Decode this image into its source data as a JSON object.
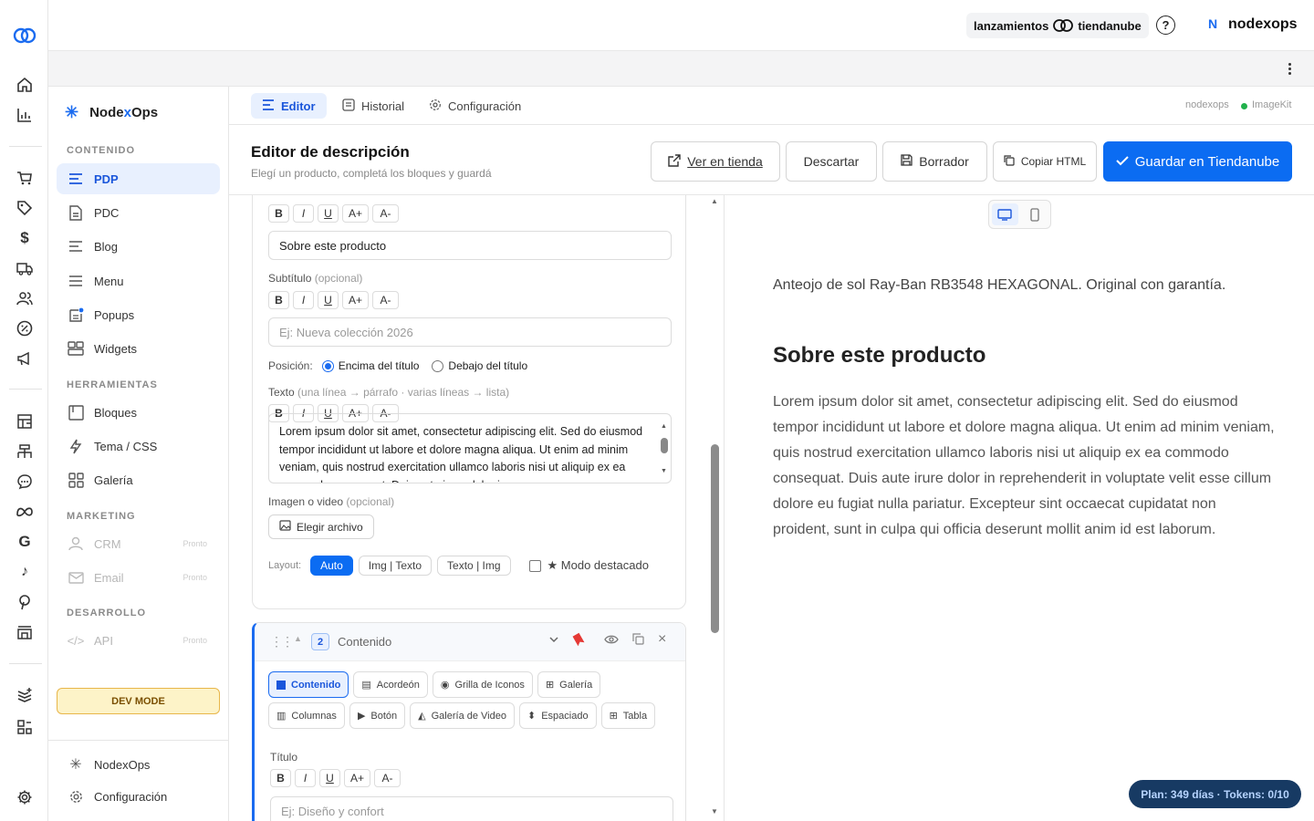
{
  "topbar": {
    "brand_left": "lanzamientos",
    "brand_right": "tiendanube",
    "user_initial": "N",
    "username": "nodexops"
  },
  "sidebar": {
    "app_name_1": "Node",
    "app_name_2": "x",
    "app_name_3": "Ops",
    "sections": {
      "contenido": "CONTENIDO",
      "herramientas": "HERRAMIENTAS",
      "marketing": "MARKETING",
      "desarrollo": "DESARROLLO"
    },
    "items": {
      "pdp": "PDP",
      "pdc": "PDC",
      "blog": "Blog",
      "menu": "Menu",
      "popups": "Popups",
      "widgets": "Widgets",
      "bloques": "Bloques",
      "tema": "Tema / CSS",
      "galeria": "Galería",
      "crm": "CRM",
      "email": "Email",
      "api": "API"
    },
    "soon": "Pronto",
    "dev_mode": "DEV MODE",
    "footer_app": "NodexOps",
    "footer_config": "Configuración"
  },
  "tabs": {
    "editor": "Editor",
    "historial": "Historial",
    "configuracion": "Configuración",
    "store": "nodexops",
    "imagekit": "ImageKit"
  },
  "header": {
    "title": "Editor de descripción",
    "subtitle": "Elegí un producto, completá los bloques y guardá",
    "ver_tienda": "Ver en tienda",
    "descartar": "Descartar",
    "borrador": "Borrador",
    "copiar_html": "Copiar HTML",
    "guardar": "Guardar en Tiendanube"
  },
  "block1": {
    "title_value": "Sobre este producto",
    "subtitle_label": "Subtítulo",
    "optional": "(opcional)",
    "subtitle_placeholder": "Ej: Nueva colección 2026",
    "position_label": "Posición:",
    "pos_above": "Encima del título",
    "pos_below": "Debajo del título",
    "text_label": "Texto",
    "text_hint": "(una línea → párrafo · varias líneas → lista)",
    "text_value": "Lorem ipsum dolor sit amet, consectetur adipiscing elit. Sed do eiusmod tempor incididunt ut labore et dolore magna aliqua. Ut enim ad minim veniam, quis nostrud exercitation ullamco laboris nisi ut aliquip ex ea commodo consequat. Duis aute irure dolor in",
    "image_label": "Imagen o video",
    "choose_file": "Elegir archivo",
    "layout_label": "Layout:",
    "layout_auto": "Auto",
    "layout_img_text": "Img | Texto",
    "layout_text_img": "Texto | Img",
    "featured": "★ Modo destacado"
  },
  "format": {
    "b": "B",
    "i": "I",
    "u": "U",
    "inc": "A+",
    "dec": "A-"
  },
  "block2": {
    "number": "2",
    "name": "Contenido",
    "types": [
      "Contenido",
      "Acordeón",
      "Grilla de Iconos",
      "Galería",
      "Columnas",
      "Botón",
      "Galería de Video",
      "Espaciado",
      "Tabla"
    ],
    "title_label": "Título",
    "title_placeholder": "Ej: Diseño y confort"
  },
  "preview": {
    "intro": "Anteojo de sol Ray-Ban RB3548 HEXAGONAL. Original con garantía.",
    "heading": "Sobre este producto",
    "body": "Lorem ipsum dolor sit amet, consectetur adipiscing elit. Sed do eiusmod tempor incididunt ut labore et dolore magna aliqua. Ut enim ad minim veniam, quis nostrud exercitation ullamco laboris nisi ut aliquip ex ea commodo consequat. Duis aute irure dolor in reprehenderit in voluptate velit esse cillum dolore eu fugiat nulla pariatur. Excepteur sint occaecat cupidatat non proident, sunt in culpa qui officia deserunt mollit anim id est laborum."
  },
  "plan_badge": "Plan: 349 días · Tokens: 0/10",
  "colors": {
    "accent": "#0b6cf2",
    "accent_soft": "#e8f0fe",
    "badge_bg": "#173a63",
    "dev_bg": "#fdf3c8"
  }
}
